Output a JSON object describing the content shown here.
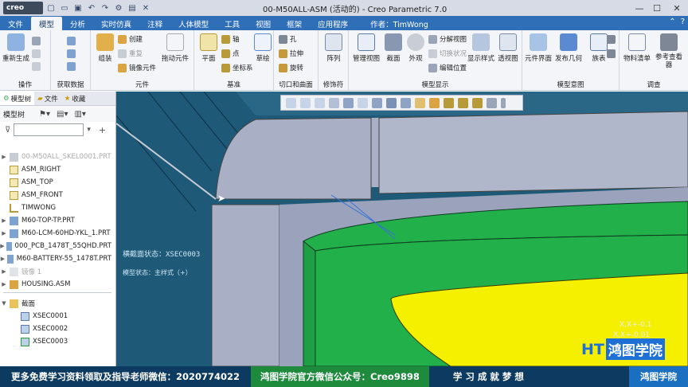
{
  "app": {
    "logo": "creo",
    "window_title": "00-M50ALL-ASM (活动的) - Creo Parametric 7.0",
    "quick_access": [
      "new-icon",
      "open-icon",
      "save-icon",
      "undo-icon",
      "redo-icon",
      "regenerate-icon",
      "window-icon",
      "close-window-icon"
    ]
  },
  "window_controls": {
    "min": "—",
    "max": "☐",
    "close": "✕"
  },
  "tabs": [
    {
      "label": "文件"
    },
    {
      "label": "模型",
      "active": true
    },
    {
      "label": "分析"
    },
    {
      "label": "实时仿真"
    },
    {
      "label": "注释"
    },
    {
      "label": "人体模型"
    },
    {
      "label": "工具"
    },
    {
      "label": "视图"
    },
    {
      "label": "框架"
    },
    {
      "label": "应用程序"
    }
  ],
  "author": "作者：TimWong",
  "ribbon": {
    "groups": {
      "operations": "操作",
      "get_data": "获取数据",
      "component": "元件",
      "datum": "基准",
      "cut_surface": "切口和曲面",
      "modifiers": "修饰符",
      "model_display": "模型显示",
      "model_intent": "模型意图",
      "investigate": "调查"
    },
    "buttons": {
      "regenerate": "重新生成",
      "assemble": "组装",
      "create": "创建",
      "repeat": "重复",
      "mirror_component": "镜像元件",
      "drag_components": "拖动元件",
      "plane": "平面",
      "axis": "轴",
      "point": "点",
      "csys": "坐标系",
      "sketch": "草绘",
      "hole": "孔",
      "extrude": "拉伸",
      "revolve": "旋转",
      "pattern": "阵列",
      "manage_views": "管理视图",
      "section": "截面",
      "appearance": "外观",
      "explode_view": "分解视图",
      "toggle_status": "切换状况",
      "edit_position": "编辑位置",
      "display_style": "显示样式",
      "perspective": "透视图",
      "component_interface": "元件界面",
      "publish_geometry": "发布几何",
      "table": "族表",
      "bom": "物料清单",
      "reference_viewer": "参考查看器"
    }
  },
  "left_panel": {
    "tabs": [
      "模型树",
      "文件",
      "收藏"
    ],
    "tree_header": "模型树",
    "filter_placeholder": "",
    "items": [
      {
        "label": "00-M50ALL_SKEL0001.PRT",
        "dim": true,
        "expand": "▶",
        "icon": "part-icon"
      },
      {
        "label": "ASM_RIGHT",
        "expand": "",
        "icon": "datum-plane-icon"
      },
      {
        "label": "ASM_TOP",
        "expand": "",
        "icon": "datum-plane-icon"
      },
      {
        "label": "ASM_FRONT",
        "expand": "",
        "icon": "datum-plane-icon"
      },
      {
        "label": "TIMWONG",
        "expand": "",
        "icon": "csys-icon"
      },
      {
        "label": "M60-TOP-TP.PRT",
        "expand": "▶",
        "icon": "part-icon"
      },
      {
        "label": "M60-LCM-60HD-YKL_1.PRT",
        "expand": "▶",
        "icon": "part-icon"
      },
      {
        "label": "000_PCB_1478T_55QHD.PRT",
        "expand": "▶",
        "icon": "part-icon"
      },
      {
        "label": "M60-BATTERY-55_1478T.PRT",
        "expand": "▶",
        "icon": "part-icon"
      },
      {
        "label": "镜像 1",
        "dim": true,
        "expand": "▶",
        "icon": "mirror-icon"
      },
      {
        "label": "HOUSING.ASM",
        "expand": "▶",
        "icon": "assembly-icon"
      },
      {
        "label": "截面",
        "expand": "▼",
        "icon": "folder-icon"
      },
      {
        "label": "XSEC0001",
        "expand": "",
        "icon": "section-icon",
        "indent": true
      },
      {
        "label": "XSEC0002",
        "expand": "",
        "icon": "section-icon",
        "indent": true
      },
      {
        "label": "XSEC0003",
        "expand": "",
        "icon": "section-icon-active",
        "indent": true
      }
    ]
  },
  "viewport": {
    "section_label": "横截面状态：XSEC0003",
    "state_label": "模型状态：主样式（+）",
    "clip_text_1": "X,X+-0.1",
    "clip_text_2": "X,X+-0.01"
  },
  "banner": {
    "left": "更多免费学习资料领取及指导老师微信：2020774022",
    "middle": "鸿图学院官方微信公众号：Creo9898",
    "slogan": "学 习 成 就 梦 想",
    "right": "鸿图学院"
  },
  "watermark": {
    "logo": "HT",
    "text": "鸿图学院"
  },
  "colors": {
    "ribbon_tab_bg": "#2f6fb8",
    "viewport_bg": "#1e5a78",
    "part_gray": "#a9b0c5",
    "pcb_green": "#22b04a",
    "battery_yellow": "#f5f000",
    "banner_bg": "#0d3a60"
  }
}
